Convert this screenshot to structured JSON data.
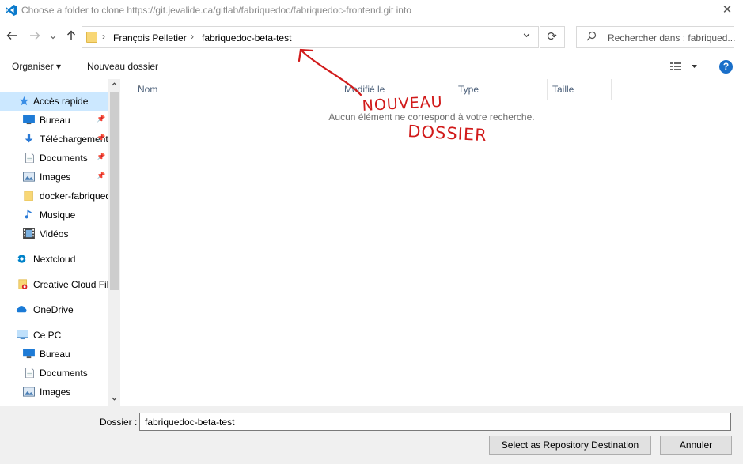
{
  "window": {
    "title": "Choose a folder to clone https://git.jevalide.ca/gitlab/fabriquedoc/fabriquedoc-frontend.git into",
    "close_glyph": "✕"
  },
  "navigation": {
    "back_icon": "arrow-left-icon",
    "forward_icon": "arrow-right-icon",
    "recent_icon": "chevron-down-icon",
    "up_icon": "arrow-up-icon",
    "breadcrumb": [
      "François Pelletier",
      "fabriquedoc-beta-test"
    ],
    "search_placeholder": "Rechercher dans : fabriqued..."
  },
  "commands": {
    "organize": "Organiser ▾",
    "new_folder": "Nouveau dossier"
  },
  "sidebar": {
    "items": [
      {
        "label": "Accès rapide",
        "icon": "star-icon",
        "selected": true
      },
      {
        "label": "Bureau",
        "icon": "desktop-icon",
        "pinned": true
      },
      {
        "label": "Téléchargements",
        "icon": "download-icon",
        "pinned": true
      },
      {
        "label": "Documents",
        "icon": "document-icon",
        "pinned": true
      },
      {
        "label": "Images",
        "icon": "image-icon",
        "pinned": true
      },
      {
        "label": "docker-fabriquedoc",
        "icon": "folder-icon"
      },
      {
        "label": "Musique",
        "icon": "music-icon"
      },
      {
        "label": "Vidéos",
        "icon": "video-icon"
      },
      {
        "label": "Nextcloud",
        "icon": "nextcloud-icon"
      },
      {
        "label": "Creative Cloud Files",
        "icon": "creative-cloud-icon"
      },
      {
        "label": "OneDrive",
        "icon": "onedrive-icon"
      },
      {
        "label": "Ce PC",
        "icon": "computer-icon"
      },
      {
        "label": "Bureau",
        "icon": "desktop-icon"
      },
      {
        "label": "Documents",
        "icon": "document-icon"
      },
      {
        "label": "Images",
        "icon": "image-icon"
      }
    ]
  },
  "content": {
    "columns": [
      "Nom",
      "Modifié le",
      "Type",
      "Taille"
    ],
    "empty_message": "Aucun élément ne correspond à votre recherche."
  },
  "annotation": {
    "line1": "NOUVEAU",
    "line2": "DOSSIER",
    "color": "#d11a1a"
  },
  "footer": {
    "folder_label": "Dossier :",
    "folder_value": "fabriquedoc-beta-test",
    "select_button": "Select as Repository Destination",
    "cancel_button": "Annuler"
  }
}
